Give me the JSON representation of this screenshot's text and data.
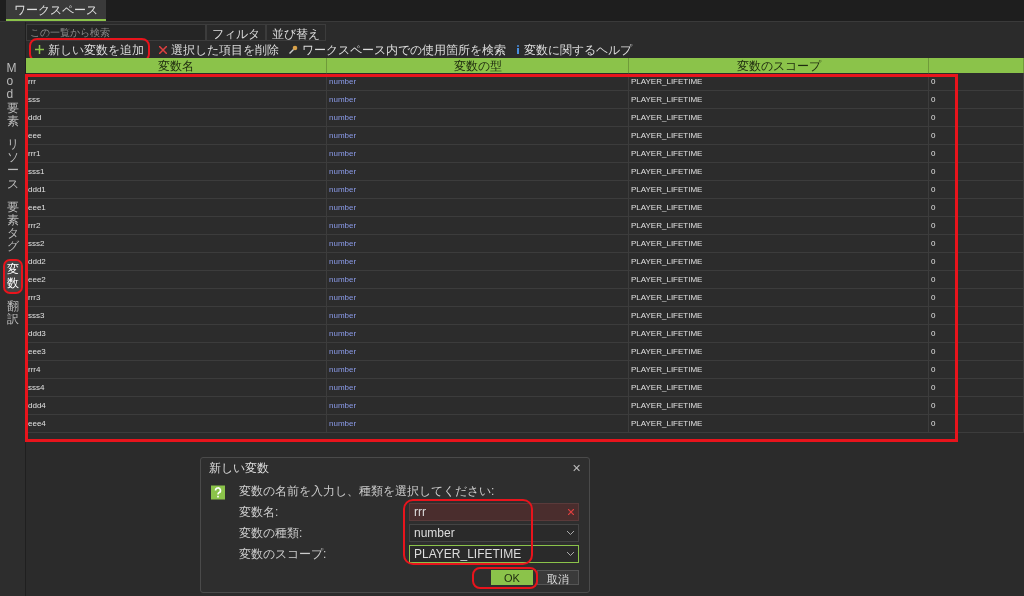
{
  "top_tabs": [
    {
      "label": "ワークスペース",
      "selected": true
    }
  ],
  "search": {
    "placeholder": "この一覧から検索"
  },
  "filter_buttons": [
    "フィルタ",
    "並び替え"
  ],
  "toolbar": [
    {
      "kind": "add",
      "label": "新しい変数を追加"
    },
    {
      "kind": "delete",
      "label": "選択した項目を削除"
    },
    {
      "kind": "find",
      "label": "ワークスペース内での使用箇所を検索"
    },
    {
      "kind": "help",
      "label": "変数に関するヘルプ"
    }
  ],
  "side_tabs": [
    {
      "label": "Mod要素",
      "selected": false
    },
    {
      "label": "リソース",
      "selected": false
    },
    {
      "label": "要素タグ",
      "selected": false
    },
    {
      "label": "変数",
      "selected": true
    },
    {
      "label": "翻訳",
      "selected": false
    }
  ],
  "table": {
    "columns": [
      "変数名",
      "変数の型",
      "変数のスコープ"
    ],
    "rows": [
      [
        "rrr",
        "number",
        "PLAYER_LIFETIME",
        "0"
      ],
      [
        "sss",
        "number",
        "PLAYER_LIFETIME",
        "0"
      ],
      [
        "ddd",
        "number",
        "PLAYER_LIFETIME",
        "0"
      ],
      [
        "eee",
        "number",
        "PLAYER_LIFETIME",
        "0"
      ],
      [
        "rrr1",
        "number",
        "PLAYER_LIFETIME",
        "0"
      ],
      [
        "sss1",
        "number",
        "PLAYER_LIFETIME",
        "0"
      ],
      [
        "ddd1",
        "number",
        "PLAYER_LIFETIME",
        "0"
      ],
      [
        "eee1",
        "number",
        "PLAYER_LIFETIME",
        "0"
      ],
      [
        "rrr2",
        "number",
        "PLAYER_LIFETIME",
        "0"
      ],
      [
        "sss2",
        "number",
        "PLAYER_LIFETIME",
        "0"
      ],
      [
        "ddd2",
        "number",
        "PLAYER_LIFETIME",
        "0"
      ],
      [
        "eee2",
        "number",
        "PLAYER_LIFETIME",
        "0"
      ],
      [
        "rrr3",
        "number",
        "PLAYER_LIFETIME",
        "0"
      ],
      [
        "sss3",
        "number",
        "PLAYER_LIFETIME",
        "0"
      ],
      [
        "ddd3",
        "number",
        "PLAYER_LIFETIME",
        "0"
      ],
      [
        "eee3",
        "number",
        "PLAYER_LIFETIME",
        "0"
      ],
      [
        "rrr4",
        "number",
        "PLAYER_LIFETIME",
        "0"
      ],
      [
        "sss4",
        "number",
        "PLAYER_LIFETIME",
        "0"
      ],
      [
        "ddd4",
        "number",
        "PLAYER_LIFETIME",
        "0"
      ],
      [
        "eee4",
        "number",
        "PLAYER_LIFETIME",
        "0"
      ]
    ]
  },
  "dialog": {
    "title": "新しい変数",
    "close": "✕",
    "message": "変数の名前を入力し、種類を選択してください:",
    "fields": [
      {
        "kind": "text",
        "label": "変数名:",
        "value": "rrr",
        "invalid": true
      },
      {
        "kind": "select",
        "label": "変数の種類:",
        "value": "number",
        "focused": false
      },
      {
        "kind": "select",
        "label": "変数のスコープ:",
        "value": "PLAYER_LIFETIME",
        "focused": true
      }
    ],
    "buttons": [
      {
        "label": "OK",
        "primary": true
      },
      {
        "label": "取消",
        "primary": false
      }
    ]
  }
}
